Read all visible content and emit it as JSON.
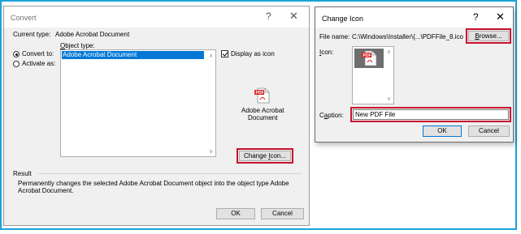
{
  "convert": {
    "title": "Convert",
    "help_glyph": "?",
    "close_glyph": "✕",
    "current_type_label": "Current type:",
    "current_type_value": "Adobe Acrobat Document",
    "object_type_label": "Object type:",
    "list_items": [
      "Adobe Acrobat Document"
    ],
    "convert_to_label": "Convert to:",
    "activate_as_label": "Activate as:",
    "display_as_icon_label": "Display as icon",
    "icon_caption_line1": "Adobe Acrobat",
    "icon_caption_line2": "Document",
    "change_icon_button": "Change Icon...",
    "result_label": "Result",
    "result_text_line1": "Permanently changes the selected Adobe Acrobat Document object into the object type Adobe",
    "result_text_line2": "Acrobat Document.",
    "ok_button": "OK",
    "cancel_button": "Cancel"
  },
  "change_icon": {
    "title": "Change Icon",
    "help_glyph": "?",
    "close_glyph": "✕",
    "file_name_label": "File name:",
    "file_name_value": "C:\\Windows\\Installer\\{...\\PDFFile_8.ico",
    "browse_button": "Browse...",
    "icon_label": "Icon:",
    "caption_label": "Caption:",
    "caption_value": "New PDF File",
    "ok_button": "OK",
    "cancel_button": "Cancel"
  },
  "colors": {
    "frame_border": "#1aa3d9",
    "highlight_red": "#c8102e",
    "selection_blue": "#0078d7",
    "pdf_red": "#d71e1e"
  }
}
